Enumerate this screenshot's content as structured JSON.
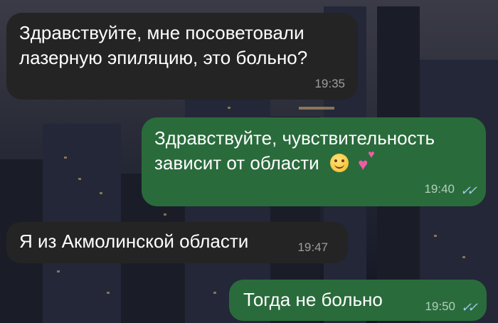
{
  "chat": {
    "messages": [
      {
        "direction": "incoming",
        "text_line1": "Здравствуйте, мне посоветовали",
        "text_line2": "лазерную эпиляцию, это больно?",
        "time": "19:35"
      },
      {
        "direction": "outgoing",
        "text_line1": "Здравствуйте, чувствительность",
        "text_line2": "зависит от области",
        "emoji": [
          "smiling-face",
          "two-hearts"
        ],
        "time": "19:40",
        "read": true
      },
      {
        "direction": "incoming",
        "text": "Я из Акмолинской области",
        "time": "19:47"
      },
      {
        "direction": "outgoing",
        "text": "Тогда не больно",
        "time": "19:50",
        "read": true
      }
    ]
  },
  "colors": {
    "incoming_bubble": "#242424",
    "outgoing_bubble": "#2a6b3c",
    "read_check": "#9ec9e6"
  }
}
